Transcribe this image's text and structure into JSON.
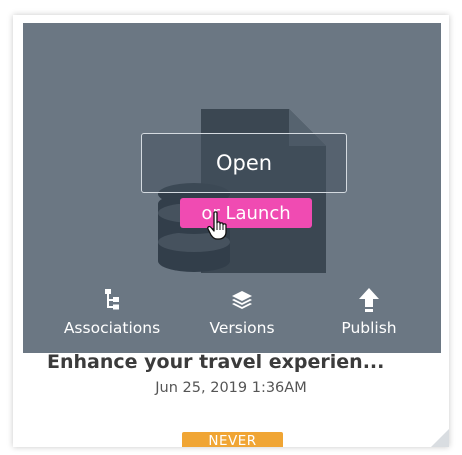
{
  "card": {
    "open_label": "Open",
    "launch_label": "or Launch",
    "title": "Enhance your travel experien...",
    "date": "Jun 25, 2019 1:36AM",
    "status_badge": "NEVER"
  },
  "actions": [
    {
      "label": "Associations",
      "icon": "hierarchy-icon"
    },
    {
      "label": "Versions",
      "icon": "layers-icon"
    },
    {
      "label": "Publish",
      "icon": "upload-arrow-icon"
    }
  ],
  "colors": {
    "thumbnail_bg": "#6b7783",
    "launch_accent": "#f04bb2",
    "badge": "#f0a534",
    "title_text": "#3b3b3b"
  }
}
